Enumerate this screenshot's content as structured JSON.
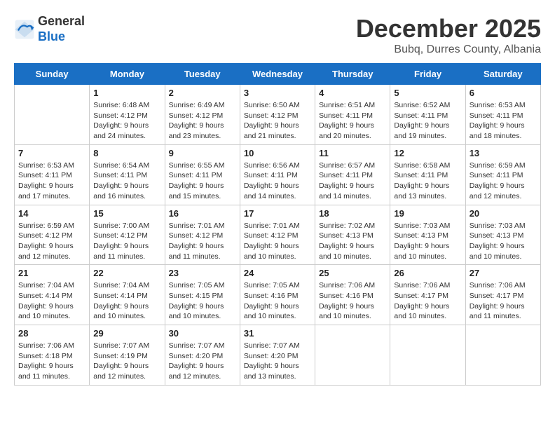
{
  "header": {
    "logo_line1": "General",
    "logo_line2": "Blue",
    "title": "December 2025",
    "subtitle": "Bubq, Durres County, Albania"
  },
  "days_of_week": [
    "Sunday",
    "Monday",
    "Tuesday",
    "Wednesday",
    "Thursday",
    "Friday",
    "Saturday"
  ],
  "weeks": [
    [
      {
        "date": "",
        "text": ""
      },
      {
        "date": "1",
        "text": "Sunrise: 6:48 AM\nSunset: 4:12 PM\nDaylight: 9 hours and 24 minutes."
      },
      {
        "date": "2",
        "text": "Sunrise: 6:49 AM\nSunset: 4:12 PM\nDaylight: 9 hours and 23 minutes."
      },
      {
        "date": "3",
        "text": "Sunrise: 6:50 AM\nSunset: 4:12 PM\nDaylight: 9 hours and 21 minutes."
      },
      {
        "date": "4",
        "text": "Sunrise: 6:51 AM\nSunset: 4:11 PM\nDaylight: 9 hours and 20 minutes."
      },
      {
        "date": "5",
        "text": "Sunrise: 6:52 AM\nSunset: 4:11 PM\nDaylight: 9 hours and 19 minutes."
      },
      {
        "date": "6",
        "text": "Sunrise: 6:53 AM\nSunset: 4:11 PM\nDaylight: 9 hours and 18 minutes."
      }
    ],
    [
      {
        "date": "7",
        "text": "Sunrise: 6:53 AM\nSunset: 4:11 PM\nDaylight: 9 hours and 17 minutes."
      },
      {
        "date": "8",
        "text": "Sunrise: 6:54 AM\nSunset: 4:11 PM\nDaylight: 9 hours and 16 minutes."
      },
      {
        "date": "9",
        "text": "Sunrise: 6:55 AM\nSunset: 4:11 PM\nDaylight: 9 hours and 15 minutes."
      },
      {
        "date": "10",
        "text": "Sunrise: 6:56 AM\nSunset: 4:11 PM\nDaylight: 9 hours and 14 minutes."
      },
      {
        "date": "11",
        "text": "Sunrise: 6:57 AM\nSunset: 4:11 PM\nDaylight: 9 hours and 14 minutes."
      },
      {
        "date": "12",
        "text": "Sunrise: 6:58 AM\nSunset: 4:11 PM\nDaylight: 9 hours and 13 minutes."
      },
      {
        "date": "13",
        "text": "Sunrise: 6:59 AM\nSunset: 4:11 PM\nDaylight: 9 hours and 12 minutes."
      }
    ],
    [
      {
        "date": "14",
        "text": "Sunrise: 6:59 AM\nSunset: 4:12 PM\nDaylight: 9 hours and 12 minutes."
      },
      {
        "date": "15",
        "text": "Sunrise: 7:00 AM\nSunset: 4:12 PM\nDaylight: 9 hours and 11 minutes."
      },
      {
        "date": "16",
        "text": "Sunrise: 7:01 AM\nSunset: 4:12 PM\nDaylight: 9 hours and 11 minutes."
      },
      {
        "date": "17",
        "text": "Sunrise: 7:01 AM\nSunset: 4:12 PM\nDaylight: 9 hours and 10 minutes."
      },
      {
        "date": "18",
        "text": "Sunrise: 7:02 AM\nSunset: 4:13 PM\nDaylight: 9 hours and 10 minutes."
      },
      {
        "date": "19",
        "text": "Sunrise: 7:03 AM\nSunset: 4:13 PM\nDaylight: 9 hours and 10 minutes."
      },
      {
        "date": "20",
        "text": "Sunrise: 7:03 AM\nSunset: 4:13 PM\nDaylight: 9 hours and 10 minutes."
      }
    ],
    [
      {
        "date": "21",
        "text": "Sunrise: 7:04 AM\nSunset: 4:14 PM\nDaylight: 9 hours and 10 minutes."
      },
      {
        "date": "22",
        "text": "Sunrise: 7:04 AM\nSunset: 4:14 PM\nDaylight: 9 hours and 10 minutes."
      },
      {
        "date": "23",
        "text": "Sunrise: 7:05 AM\nSunset: 4:15 PM\nDaylight: 9 hours and 10 minutes."
      },
      {
        "date": "24",
        "text": "Sunrise: 7:05 AM\nSunset: 4:16 PM\nDaylight: 9 hours and 10 minutes."
      },
      {
        "date": "25",
        "text": "Sunrise: 7:06 AM\nSunset: 4:16 PM\nDaylight: 9 hours and 10 minutes."
      },
      {
        "date": "26",
        "text": "Sunrise: 7:06 AM\nSunset: 4:17 PM\nDaylight: 9 hours and 10 minutes."
      },
      {
        "date": "27",
        "text": "Sunrise: 7:06 AM\nSunset: 4:17 PM\nDaylight: 9 hours and 11 minutes."
      }
    ],
    [
      {
        "date": "28",
        "text": "Sunrise: 7:06 AM\nSunset: 4:18 PM\nDaylight: 9 hours and 11 minutes."
      },
      {
        "date": "29",
        "text": "Sunrise: 7:07 AM\nSunset: 4:19 PM\nDaylight: 9 hours and 12 minutes."
      },
      {
        "date": "30",
        "text": "Sunrise: 7:07 AM\nSunset: 4:20 PM\nDaylight: 9 hours and 12 minutes."
      },
      {
        "date": "31",
        "text": "Sunrise: 7:07 AM\nSunset: 4:20 PM\nDaylight: 9 hours and 13 minutes."
      },
      {
        "date": "",
        "text": ""
      },
      {
        "date": "",
        "text": ""
      },
      {
        "date": "",
        "text": ""
      }
    ]
  ]
}
